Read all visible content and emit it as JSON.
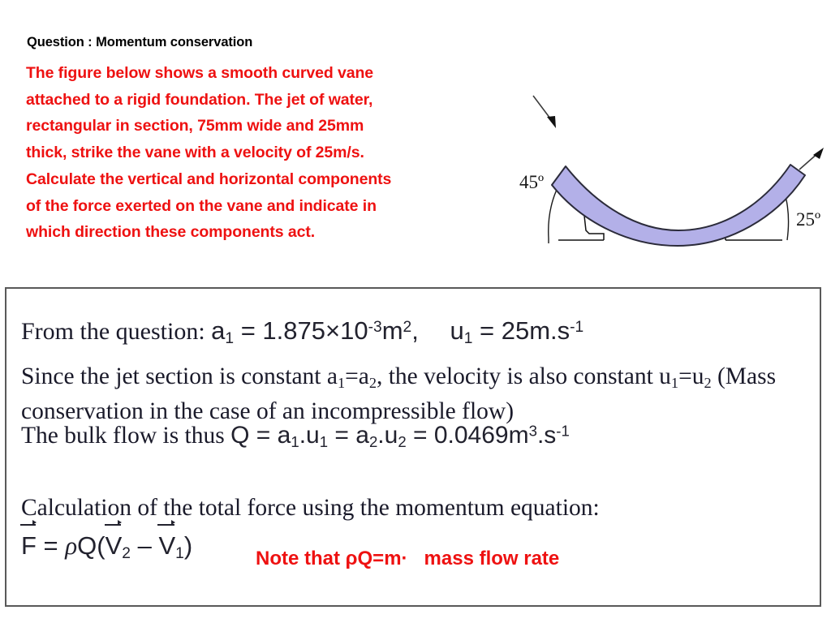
{
  "slide": {
    "heading": "Question : Momentum conservation",
    "question_text": "The figure below shows a smooth curved vane attached to a rigid foundation. The jet of water, rectangular in section, 75mm wide and 25mm thick, strike the vane with a velocity of 25m/s. Calculate the vertical and horizontal components of the force exerted on the vane and indicate in",
    "question_lines": [
      "The figure below shows a smooth curved vane",
      "attached to a rigid foundation. The jet of water,",
      "rectangular in section, 75mm wide and 25mm",
      "thick, strike the vane with a velocity of 25m/s.",
      "Calculate the vertical and horizontal components",
      "of the force exerted on the vane and indicate in",
      "which direction these components act."
    ],
    "heading_color": "#000000",
    "question_color": "#ee1111"
  },
  "figure": {
    "name": "curved-vane-diagram",
    "inlet_angle_label": "45º",
    "outlet_angle_label": "25º",
    "vane_fill_color": "#b3b0e8",
    "vane_stroke_color": "#2b2b3a",
    "support_stroke_color": "#111111",
    "arrow_color": "#3b3b3b"
  },
  "equations": {
    "line1": {
      "prefix": "From the question:",
      "area_symbol": "a",
      "area_sub": "1",
      "area_value": "= 1.875×10",
      "area_exp": "-3",
      "area_unit": "m",
      "area_unit_exp": "2",
      "comma": ",",
      "vel_symbol": "u",
      "vel_sub": "1",
      "vel_value": "= 25m.s",
      "vel_exp": "-1"
    },
    "line2": {
      "part_a": "Since the jet section is constant a",
      "sub_a1": "1",
      "eq1": "=a",
      "sub_a2": "2",
      "part_b": ", the velocity is also constant u",
      "sub_u1": "1",
      "eq2": "=u",
      "sub_u2": "2",
      "part_c": " (Mass conservation in the case of an incompressible flow)"
    },
    "line3": {
      "prefix": "The bulk flow is thus",
      "q": "Q = a",
      "sub1": "1",
      "mid1": ".u",
      "sub2": "1",
      "mid2": " = a",
      "sub3": "2",
      "mid3": ".u",
      "sub4": "2",
      "result": " = 0.0469m",
      "result_exp": "3",
      "result_unit": ".s",
      "result_unit_exp": "-1"
    },
    "line4": "Calculation of the total force using the momentum equation:",
    "formula": {
      "f": "F",
      "equals": " = ",
      "rho": "ρ",
      "q": "Q(",
      "v2": "V",
      "v2sub": "2",
      "minus": " – ",
      "v1": "V",
      "v1sub": "1",
      "close": ")"
    }
  },
  "note": {
    "text": "Note that ρQ=m·   mass flow rate",
    "color": "#ee1111"
  }
}
